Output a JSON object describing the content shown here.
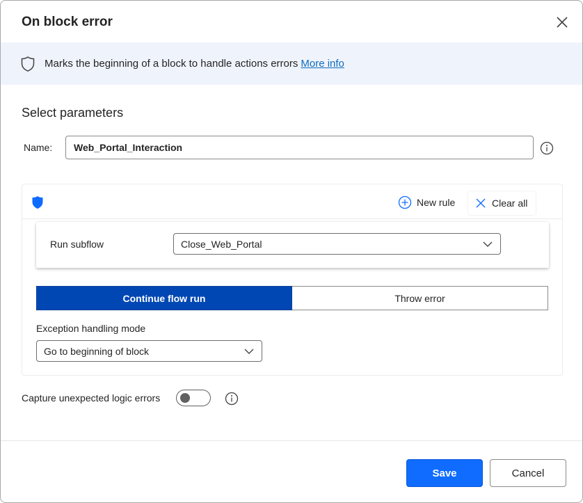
{
  "dialog": {
    "title": "On block error",
    "close_icon": "close-icon"
  },
  "banner": {
    "icon": "shield-outline-icon",
    "text": "Marks the beginning of a block to handle actions errors",
    "link": "More info"
  },
  "parameters": {
    "section_title": "Select parameters",
    "name_label": "Name:",
    "name_value": "Web_Portal_Interaction"
  },
  "rules": {
    "header_icon": "shield-filled-icon",
    "new_rule_label": "New rule",
    "clear_all_label": "Clear all",
    "rule": {
      "label": "Run subflow",
      "selected": "Close_Web_Portal"
    },
    "mode_toggle": {
      "options": [
        "Continue flow run",
        "Throw error"
      ],
      "selected": "Continue flow run"
    },
    "exception_mode_label": "Exception handling mode",
    "exception_mode_selected": "Go to beginning of block"
  },
  "capture": {
    "label": "Capture unexpected logic errors",
    "enabled": false
  },
  "footer": {
    "save_label": "Save",
    "cancel_label": "Cancel"
  },
  "colors": {
    "accent": "#0f6cff",
    "segment_active": "#0047b3",
    "banner_bg": "#eff4fc",
    "link": "#0f6cbd"
  }
}
